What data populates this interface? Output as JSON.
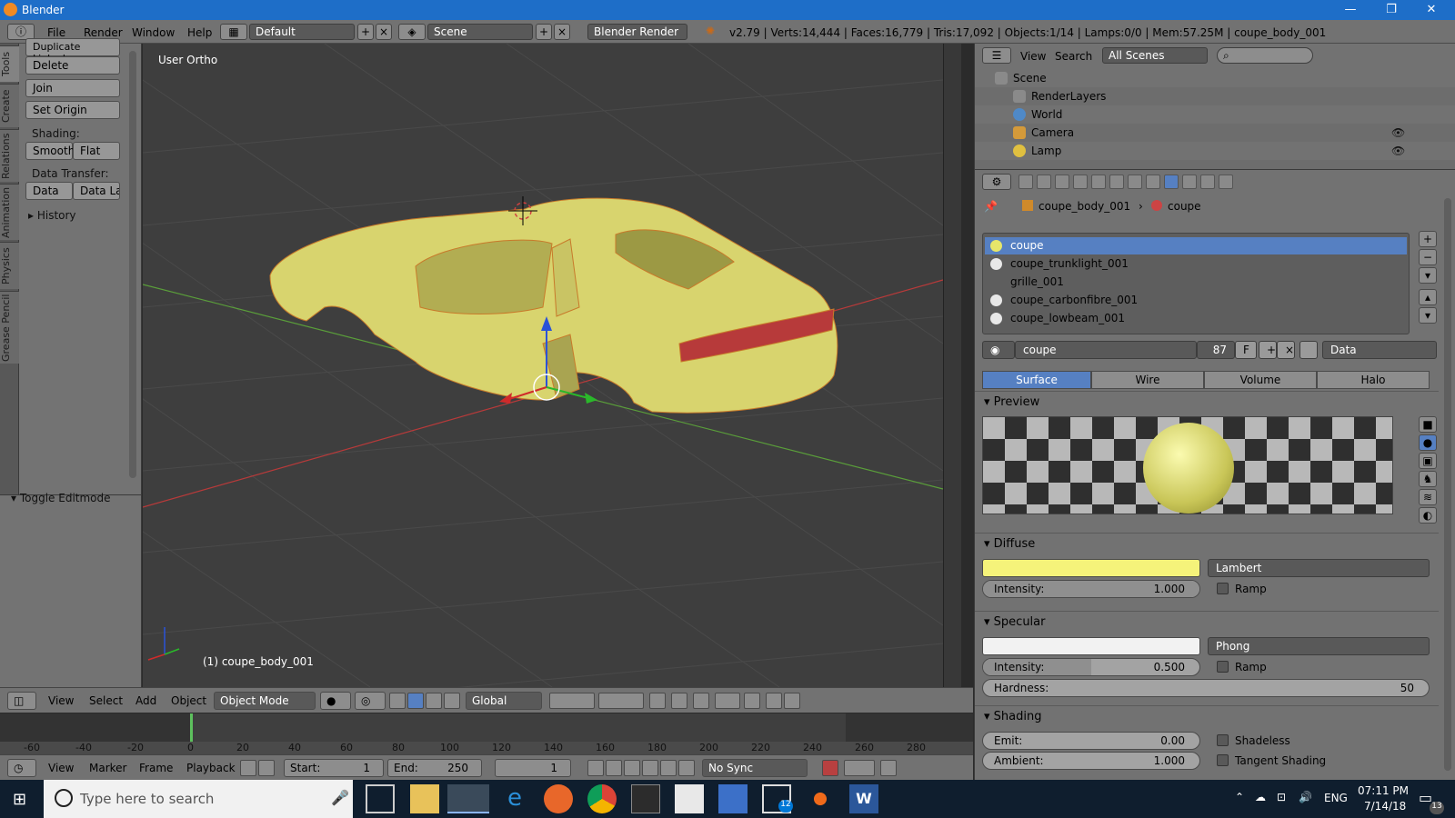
{
  "window": {
    "title": "Blender",
    "min": "—",
    "max": "❐",
    "close": "✕"
  },
  "topbar": {
    "menus": [
      "File",
      "Render",
      "Window",
      "Help"
    ],
    "layout": "Default",
    "scene": "Scene",
    "engine": "Blender Render",
    "stats": "v2.79 | Verts:14,444 | Faces:16,779 | Tris:17,092 | Objects:1/14 | Lamps:0/0 | Mem:57.25M | coupe_body_001"
  },
  "tabs": [
    "Tools",
    "Create",
    "Relations",
    "Animation",
    "Physics",
    "Grease Pencil"
  ],
  "toolshelf": {
    "duplicate_linked": "Duplicate Linked",
    "delete": "Delete",
    "join": "Join",
    "set_origin": "Set Origin",
    "shading_label": "Shading:",
    "smooth": "Smooth",
    "flat": "Flat",
    "data_transfer_label": "Data Transfer:",
    "data": "Data",
    "data_la": "Data La",
    "history": "History",
    "toggle_editmode": "Toggle Editmode"
  },
  "viewport": {
    "view_name": "User Ortho",
    "object_label": "(1) coupe_body_001"
  },
  "view3d_header": {
    "menus": [
      "View",
      "Select",
      "Add",
      "Object"
    ],
    "mode": "Object Mode",
    "orientation": "Global"
  },
  "timeline": {
    "ticks": [
      "-60",
      "-40",
      "-20",
      "0",
      "20",
      "40",
      "60",
      "80",
      "100",
      "120",
      "140",
      "160",
      "180",
      "200",
      "220",
      "240",
      "260",
      "280"
    ],
    "menus": [
      "View",
      "Marker",
      "Frame",
      "Playback"
    ],
    "start_label": "Start:",
    "start": "1",
    "end_label": "End:",
    "end": "250",
    "current": "1",
    "sync": "No Sync",
    "current_frame": 0
  },
  "outliner": {
    "menus": [
      "View",
      "Search"
    ],
    "scenes_filter": "All Scenes",
    "items": [
      "Scene",
      "RenderLayers",
      "World",
      "Camera",
      "Lamp"
    ]
  },
  "properties": {
    "breadcrumb_object": "coupe_body_001",
    "breadcrumb_material": "coupe",
    "materials": [
      "coupe",
      "coupe_trunklight_001",
      "grille_001",
      "coupe_carbonfibre_001",
      "coupe_lowbeam_001"
    ],
    "material_name": "coupe",
    "users": "87",
    "fake": "F",
    "link": "Data",
    "tabs": [
      "Surface",
      "Wire",
      "Volume",
      "Halo"
    ],
    "preview_label": "Preview",
    "diffuse": {
      "label": "Diffuse",
      "shader": "Lambert",
      "intensity_label": "Intensity:",
      "intensity": "1.000",
      "ramp": "Ramp",
      "color": "#f5f37a"
    },
    "specular": {
      "label": "Specular",
      "shader": "Phong",
      "intensity_label": "Intensity:",
      "intensity": "0.500",
      "ramp": "Ramp",
      "hardness_label": "Hardness:",
      "hardness": "50"
    },
    "shading": {
      "label": "Shading",
      "emit_label": "Emit:",
      "emit": "0.00",
      "shadeless": "Shadeless",
      "ambient_label": "Ambient:",
      "ambient": "1.000",
      "tangent": "Tangent Shading"
    }
  },
  "taskbar": {
    "search_placeholder": "Type here to search",
    "lang": "ENG",
    "time": "07:11 PM",
    "date": "7/14/18",
    "mail_badge": "12",
    "notif_badge": "13"
  }
}
